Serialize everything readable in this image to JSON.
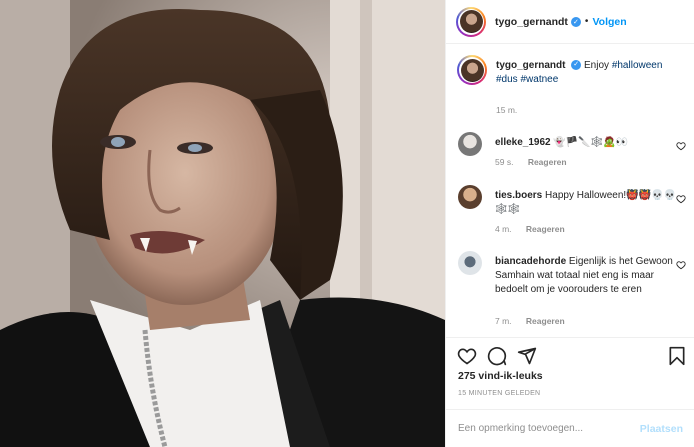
{
  "post": {
    "author": "tygo_gernandt",
    "follow_label": "Volgen",
    "dot": "•",
    "verified_mark": "✓"
  },
  "caption": {
    "user": "tygo_gernandt",
    "text": "Enjoy",
    "tag1": "#halloween",
    "tag2": "#dus",
    "tag3": "#watnee",
    "time": "15 m."
  },
  "comments": [
    {
      "user": "elleke_1962",
      "text": "👻🏴🔪🕸️🧟👀",
      "time": "59 s.",
      "reply": "Reageren"
    },
    {
      "user": "ties.boers",
      "text": "Happy Halloween!👹👹💀💀🕸️🕸️",
      "time": "4 m.",
      "reply": "Reageren"
    },
    {
      "user": "biancadehorde",
      "text": "Eigenlijk is het Gewoon Samhain wat totaal niet eng is maar bedoelt om je voorouders te eren",
      "time": "7 m.",
      "reply": "Reageren"
    }
  ],
  "stats": {
    "likes": "275 vind-ik-leuks",
    "posted": "15 MINUTEN GELEDEN"
  },
  "add_comment": {
    "placeholder": "Een opmerking toevoegen...",
    "post_label": "Plaatsen"
  },
  "icons": {
    "like": "heart-icon",
    "comment": "comment-icon",
    "share": "share-icon",
    "save": "bookmark-icon"
  },
  "colors": {
    "accent": "#0095f6",
    "verified": "#3897f0",
    "post_disabled": "#b2dffc",
    "muted": "#8e8e8e"
  }
}
